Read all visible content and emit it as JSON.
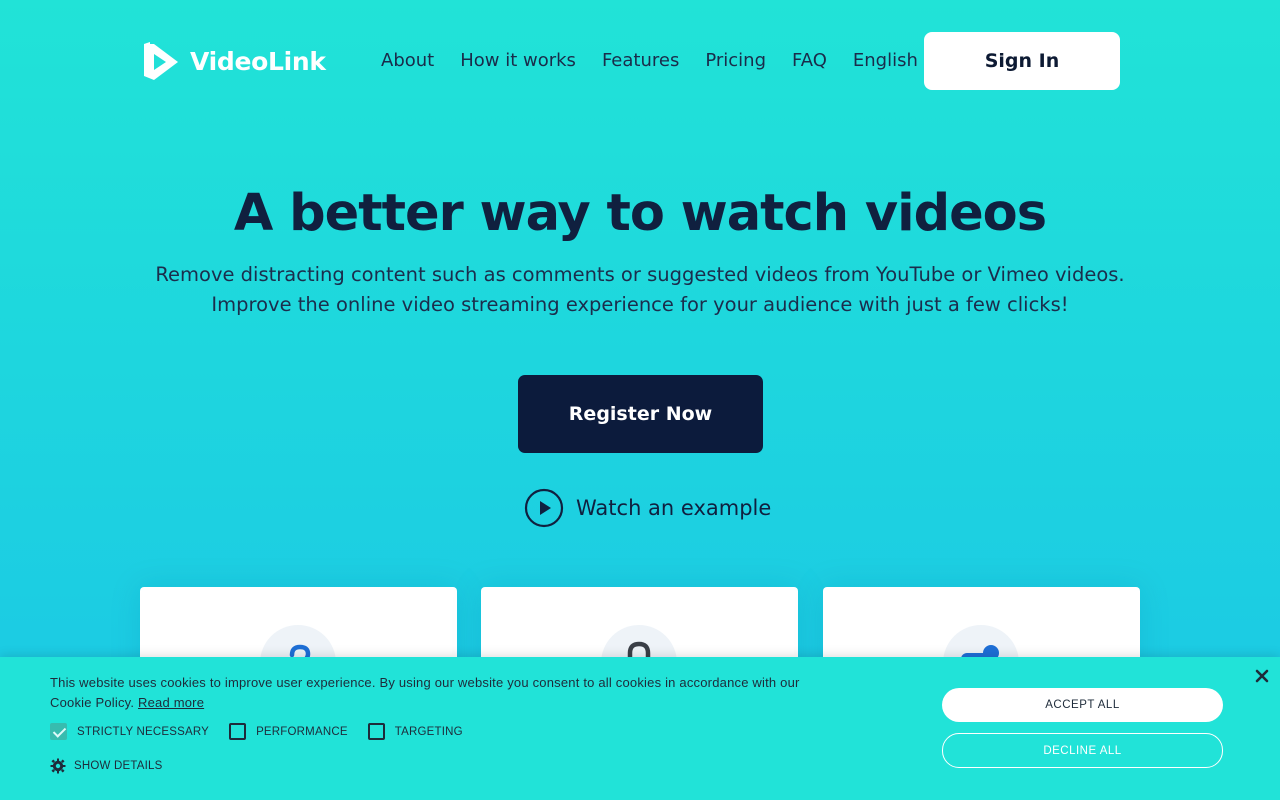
{
  "brand": {
    "name": "VideoLink",
    "logo_icon": "play-logo-icon"
  },
  "nav": {
    "items": [
      {
        "label": "About"
      },
      {
        "label": "How it works"
      },
      {
        "label": "Features"
      },
      {
        "label": "Pricing"
      },
      {
        "label": "FAQ"
      }
    ],
    "language": "English",
    "signin_label": "Sign In"
  },
  "hero": {
    "title": "A better way to watch videos",
    "subtitle": "Remove distracting content such as comments or suggested videos from YouTube or Vimeo videos. Improve the online video streaming experience for your audience with just a few clicks!",
    "register_label": "Register Now",
    "watch_label": "Watch an example"
  },
  "cards": [
    {
      "icon": "question-icon"
    },
    {
      "icon": "lock-icon"
    },
    {
      "icon": "toggle-icon"
    }
  ],
  "cookie_banner": {
    "text": "This website uses cookies to improve user experience. By using our website you consent to all cookies in accordance with our Cookie Policy.",
    "read_more": "Read more",
    "options": [
      {
        "label": "STRICTLY NECESSARY",
        "checked": true
      },
      {
        "label": "PERFORMANCE",
        "checked": false
      },
      {
        "label": "TARGETING",
        "checked": false
      }
    ],
    "show_details": "SHOW DETAILS",
    "accept_label": "ACCEPT ALL",
    "decline_label": "DECLINE ALL"
  },
  "colors": {
    "background_top": "#21e3d7",
    "background_bottom": "#1bc6e6",
    "primary_dark": "#0c1b3c",
    "white": "#ffffff"
  }
}
